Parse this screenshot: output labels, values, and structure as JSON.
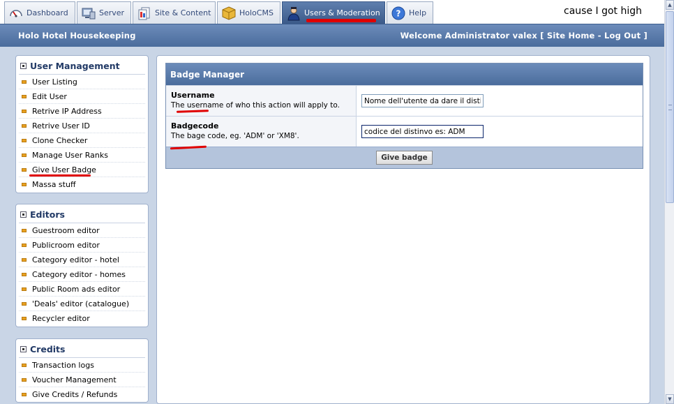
{
  "tabs": [
    {
      "label": "Dashboard",
      "icon": "gauge-icon"
    },
    {
      "label": "Server",
      "icon": "server-icon"
    },
    {
      "label": "Site & Content",
      "icon": "pages-icon"
    },
    {
      "label": "HoloCMS",
      "icon": "box-icon"
    },
    {
      "label": "Users & Moderation",
      "icon": "user-icon",
      "active": true
    },
    {
      "label": "Help",
      "icon": "help-icon"
    }
  ],
  "tagline": "cause I got high",
  "header": {
    "title": "Holo Hotel Housekeeping",
    "welcome_prefix": "Welcome Administrator valex [",
    "site_home": "Site Home",
    "separator": "-",
    "log_out": "Log Out",
    "welcome_suffix": "]"
  },
  "sidebar": {
    "user_management": {
      "title": "User Management",
      "items": [
        "User Listing",
        "Edit User",
        "Retrive IP Address",
        "Retrive User ID",
        "Clone Checker",
        "Manage User Ranks",
        "Give User Badge",
        "Massa stuff"
      ]
    },
    "editors": {
      "title": "Editors",
      "items": [
        "Guestroom editor",
        "Publicroom editor",
        "Category editor - hotel",
        "Category editor - homes",
        "Public Room ads editor",
        "'Deals' editor (catalogue)",
        "Recycler editor"
      ]
    },
    "credits": {
      "title": "Credits",
      "items": [
        "Transaction logs",
        "Voucher Management",
        "Give Credits / Refunds"
      ]
    }
  },
  "badge_manager": {
    "title": "Badge Manager",
    "username": {
      "label": "Username",
      "description": "The username of who this action will apply to.",
      "value": "Nome dell'utente da dare il distintivo"
    },
    "badgecode": {
      "label": "Badgecode",
      "description": "The bage code, eg. 'ADM' or 'XM8'.",
      "value": "codice del distinvo es: ADM"
    },
    "submit_label": "Give badge"
  },
  "colors": {
    "accent": "#4a6c9c",
    "annotation": "#e00000",
    "bullet": "#e8a020"
  }
}
